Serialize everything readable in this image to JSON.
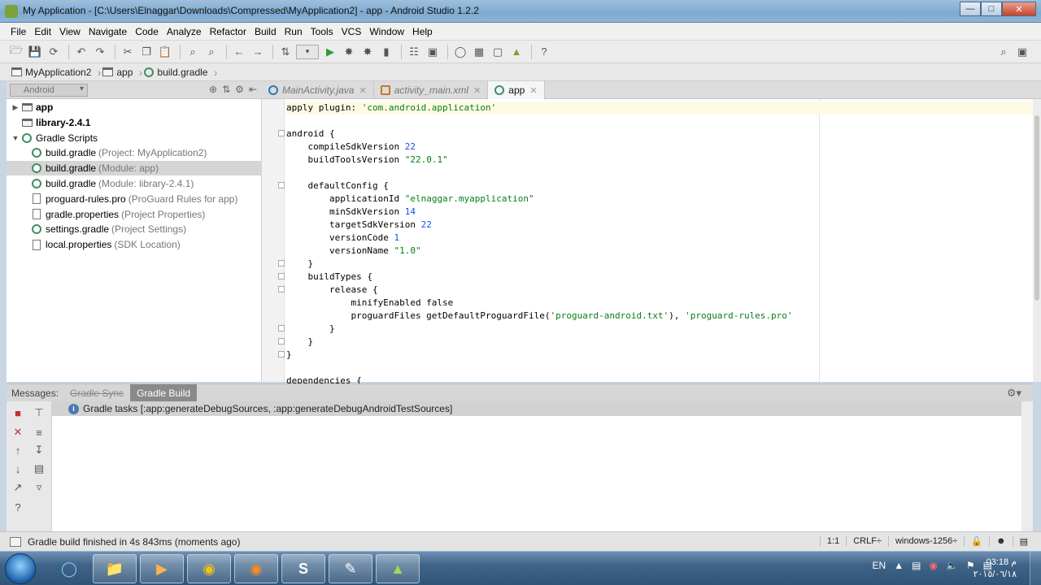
{
  "window": {
    "title": "My Application - [C:\\Users\\Elnaggar\\Downloads\\Compressed\\MyApplication2] - app - Android Studio 1.2.2"
  },
  "menu": [
    "File",
    "Edit",
    "View",
    "Navigate",
    "Code",
    "Analyze",
    "Refactor",
    "Build",
    "Run",
    "Tools",
    "VCS",
    "Window",
    "Help"
  ],
  "breadcrumb": [
    "MyApplication2",
    "app",
    "build.gradle"
  ],
  "project_panel": {
    "view_mode": "Android",
    "tree": [
      {
        "label": "app",
        "hint": "",
        "bold": true,
        "icon": "folder-module-icon",
        "arrow": "▶",
        "indent": 0,
        "selected": false
      },
      {
        "label": "library-2.4.1",
        "hint": "",
        "bold": true,
        "icon": "folder-module-icon",
        "arrow": "",
        "indent": 0,
        "selected": false
      },
      {
        "label": "Gradle Scripts",
        "hint": "",
        "bold": false,
        "icon": "gradle-icon",
        "arrow": "▼",
        "indent": 0,
        "selected": false
      },
      {
        "label": "build.gradle",
        "hint": "(Project: MyApplication2)",
        "bold": false,
        "icon": "gradle-icon",
        "arrow": "",
        "indent": 1,
        "selected": false
      },
      {
        "label": "build.gradle",
        "hint": "(Module: app)",
        "bold": false,
        "icon": "gradle-icon",
        "arrow": "",
        "indent": 1,
        "selected": true
      },
      {
        "label": "build.gradle",
        "hint": "(Module: library-2.4.1)",
        "bold": false,
        "icon": "gradle-icon",
        "arrow": "",
        "indent": 1,
        "selected": false
      },
      {
        "label": "proguard-rules.pro",
        "hint": "(ProGuard Rules for app)",
        "bold": false,
        "icon": "file-icon",
        "arrow": "",
        "indent": 1,
        "selected": false
      },
      {
        "label": "gradle.properties",
        "hint": "(Project Properties)",
        "bold": false,
        "icon": "file-icon",
        "arrow": "",
        "indent": 1,
        "selected": false
      },
      {
        "label": "settings.gradle",
        "hint": "(Project Settings)",
        "bold": false,
        "icon": "gradle-icon",
        "arrow": "",
        "indent": 1,
        "selected": false
      },
      {
        "label": "local.properties",
        "hint": "(SDK Location)",
        "bold": false,
        "icon": "file-icon",
        "arrow": "",
        "indent": 1,
        "selected": false
      }
    ]
  },
  "editor_tabs": [
    {
      "label": "MainActivity.java",
      "active": false
    },
    {
      "label": "activity_main.xml",
      "active": false
    },
    {
      "label": "app",
      "active": true
    }
  ],
  "code_lines": [
    "apply plugin: 'com.android.application'",
    "",
    "android {",
    "    compileSdkVersion 22",
    "    buildToolsVersion \"22.0.1\"",
    "",
    "    defaultConfig {",
    "        applicationId \"elnaggar.myapplication\"",
    "        minSdkVersion 14",
    "        targetSdkVersion 22",
    "        versionCode 1",
    "        versionName \"1.0\"",
    "    }",
    "    buildTypes {",
    "        release {",
    "            minifyEnabled false",
    "            proguardFiles getDefaultProguardFile('proguard-android.txt'), 'proguard-rules.pro'",
    "        }",
    "    }",
    "}",
    "",
    "dependencies {"
  ],
  "messages": {
    "label": "Messages:",
    "tabs": [
      "Gradle Sync",
      "Gradle Build"
    ],
    "row": "Gradle tasks [:app:generateDebugSources, :app:generateDebugAndroidTestSources]"
  },
  "status": {
    "text": "Gradle build finished in 4s 843ms (moments ago)",
    "position": "1:1",
    "line_sep": "CRLF÷",
    "encoding": "windows-1256÷"
  },
  "taskbar": {
    "lang": "EN",
    "time": "03:18 م",
    "date": "٢٠١٥/٠٦/١٨"
  }
}
